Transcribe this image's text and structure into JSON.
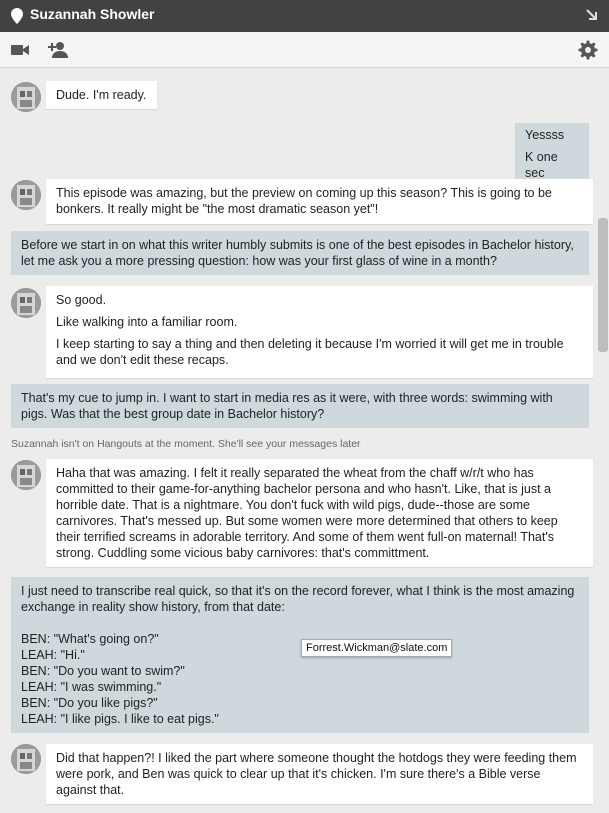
{
  "header": {
    "contact_name": "Suzannah Showler",
    "icons": [
      "location-pin-icon",
      "popout-arrow-icon"
    ]
  },
  "toolbar": {
    "icons": [
      "video-call-icon",
      "add-person-icon",
      "settings-gear-icon"
    ]
  },
  "status_message": "Suzannah isn't on Hangouts at the moment. She'll see your messages later",
  "tooltip": "Forrest.Wickman@slate.com",
  "messages": [
    {
      "from": "them",
      "lines": [
        "Dude. I'm ready."
      ]
    },
    {
      "from": "me",
      "lines": [
        "Yessss",
        "K one sec"
      ]
    },
    {
      "from": "them",
      "lines": [
        "This episode was amazing, but the preview on coming up this season? This is going to be bonkers. It really might be \"the most dramatic season yet\"!"
      ]
    },
    {
      "from": "me",
      "lines": [
        "Before we start in on what this writer humbly submits is one of the best episodes in Bachelor history, let me ask you a more pressing question: how was your first glass of wine in a month?"
      ]
    },
    {
      "from": "them",
      "lines": [
        "So good.",
        "Like walking into a familiar room.",
        "I keep starting to say a thing and then deleting it because I'm worried it will get me in trouble and we don't edit these recaps."
      ]
    },
    {
      "from": "me",
      "lines": [
        "That's my cue to jump in. I want to start in media res as it were, with three words: swimming with pigs. Was that the best group date in Bachelor history?"
      ]
    },
    {
      "from": "them",
      "lines": [
        "Haha that was amazing. I felt it really separated the wheat from the chaff w/r/t who has committed to their game-for-anything bachelor persona and who hasn't. Like, that is just a horrible date. That is a nightmare. You don't fuck with wild pigs, dude--those are some carnivores. That's messed up. But some women were more determined that others to keep their terrified screams in adorable territory. And some of them went full-on maternal! That's strong. Cuddling some vicious baby carnivores: that's committment."
      ]
    },
    {
      "from": "me",
      "lines": [
        "I just need to transcribe real quick, so that it's on the record forever, what I think is the most amazing exchange in reality show history, from that date:",
        "BEN: \"What's going on?\"",
        "LEAH: \"Hi.\"",
        "BEN: \"Do you want to swim?\"",
        "LEAH: \"I was swimming.\"",
        "BEN: \"Do you like pigs?\"",
        "LEAH: \"I like pigs. I like to eat pigs.\""
      ]
    },
    {
      "from": "them",
      "lines": [
        "Did that happen?! I liked the part where someone thought the hotdogs they were feeding them were pork, and Ben was quick to clear up that it's chicken. I'm sure there's a Bible verse against that."
      ]
    }
  ]
}
